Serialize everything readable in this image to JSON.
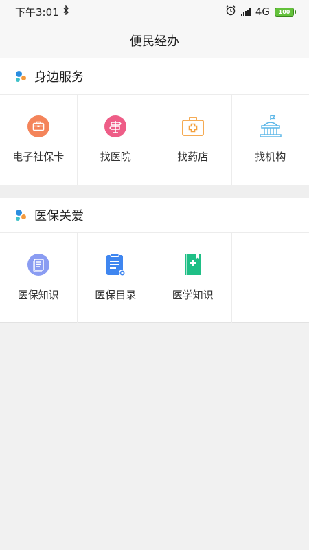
{
  "status": {
    "time": "下午3:01",
    "network": "4G",
    "battery": "100"
  },
  "nav": {
    "title": "便民经办"
  },
  "sections": [
    {
      "title": "身边服务",
      "items": [
        {
          "label": "电子社保卡",
          "icon": "briefcase-icon",
          "color": "#f4845a"
        },
        {
          "label": "找医院",
          "icon": "signpost-icon",
          "color": "#ee5d87"
        },
        {
          "label": "找药店",
          "icon": "medical-kit-icon",
          "color": "#f4a13f"
        },
        {
          "label": "找机构",
          "icon": "building-icon",
          "color": "#5fb8e8"
        }
      ]
    },
    {
      "title": "医保关爱",
      "items": [
        {
          "label": "医保知识",
          "icon": "notes-icon",
          "color": "#8a9cf2"
        },
        {
          "label": "医保目录",
          "icon": "clipboard-list-icon",
          "color": "#3f86f0"
        },
        {
          "label": "医学知识",
          "icon": "medical-book-icon",
          "color": "#1fbf86"
        }
      ]
    }
  ],
  "colors": {
    "dot_blue": "#2a8de0",
    "dot_orange": "#f39a3e",
    "dot_teal": "#3fc1c9"
  }
}
